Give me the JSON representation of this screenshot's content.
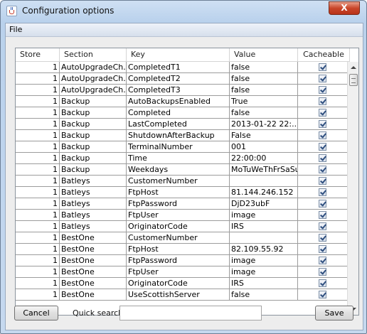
{
  "window": {
    "title": "Configuration options",
    "close_symbol": "X"
  },
  "menu": {
    "file_label": "File"
  },
  "table": {
    "columns": [
      "Store",
      "Section",
      "Key",
      "Value",
      "Cacheable"
    ],
    "rows": [
      {
        "store": "1",
        "section": "AutoUpgradeCh...",
        "key": "CompletedT1",
        "value": "false",
        "cacheable": true
      },
      {
        "store": "1",
        "section": "AutoUpgradeCh...",
        "key": "CompletedT2",
        "value": "false",
        "cacheable": true
      },
      {
        "store": "1",
        "section": "AutoUpgradeCh...",
        "key": "CompletedT3",
        "value": "false",
        "cacheable": true
      },
      {
        "store": "1",
        "section": "Backup",
        "key": "AutoBackupsEnabled",
        "value": "True",
        "cacheable": true
      },
      {
        "store": "1",
        "section": "Backup",
        "key": "Completed",
        "value": "false",
        "cacheable": true
      },
      {
        "store": "1",
        "section": "Backup",
        "key": "LastCompleted",
        "value": "2013-01-22 22:...",
        "cacheable": true
      },
      {
        "store": "1",
        "section": "Backup",
        "key": "ShutdownAfterBackup",
        "value": "False",
        "cacheable": true
      },
      {
        "store": "1",
        "section": "Backup",
        "key": "TerminalNumber",
        "value": "001",
        "cacheable": true
      },
      {
        "store": "1",
        "section": "Backup",
        "key": "Time",
        "value": "22:00:00",
        "cacheable": true
      },
      {
        "store": "1",
        "section": "Backup",
        "key": "Weekdays",
        "value": "MoTuWeThFrSaSu",
        "cacheable": true
      },
      {
        "store": "1",
        "section": "Batleys",
        "key": "CustomerNumber",
        "value": "",
        "cacheable": true
      },
      {
        "store": "1",
        "section": "Batleys",
        "key": "FtpHost",
        "value": "81.144.246.152",
        "cacheable": true
      },
      {
        "store": "1",
        "section": "Batleys",
        "key": "FtpPassword",
        "value": "DjD23ubF",
        "cacheable": true
      },
      {
        "store": "1",
        "section": "Batleys",
        "key": "FtpUser",
        "value": "image",
        "cacheable": true
      },
      {
        "store": "1",
        "section": "Batleys",
        "key": "OriginatorCode",
        "value": "IRS",
        "cacheable": true
      },
      {
        "store": "1",
        "section": "BestOne",
        "key": "CustomerNumber",
        "value": "",
        "cacheable": true
      },
      {
        "store": "1",
        "section": "BestOne",
        "key": "FtpHost",
        "value": "82.109.55.92",
        "cacheable": true
      },
      {
        "store": "1",
        "section": "BestOne",
        "key": "FtpPassword",
        "value": "image",
        "cacheable": true
      },
      {
        "store": "1",
        "section": "BestOne",
        "key": "FtpUser",
        "value": "image",
        "cacheable": true
      },
      {
        "store": "1",
        "section": "BestOne",
        "key": "OriginatorCode",
        "value": "IRS",
        "cacheable": true
      },
      {
        "store": "1",
        "section": "BestOne",
        "key": "UseScottishServer",
        "value": "false",
        "cacheable": true
      }
    ]
  },
  "footer": {
    "cancel_label": "Cancel",
    "search_label": "Quick search",
    "search_value": "",
    "save_label": "Save"
  }
}
